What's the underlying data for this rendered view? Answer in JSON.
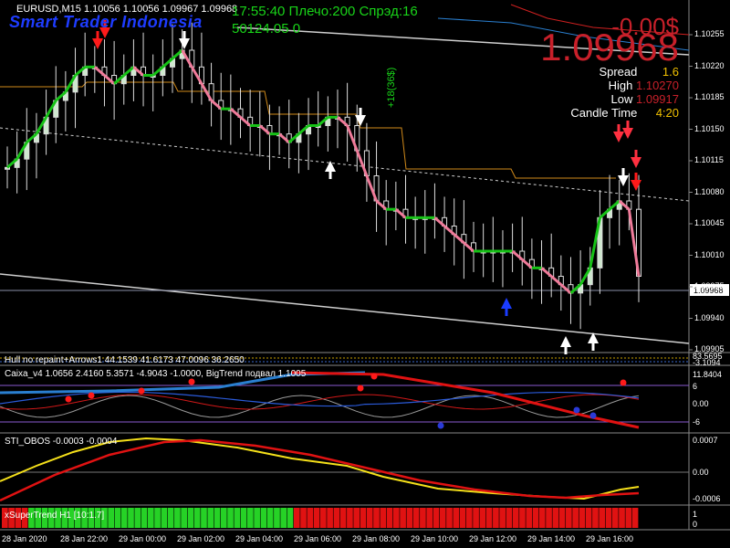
{
  "header": {
    "symbol_line": "EURUSD,M15  1.10056 1.10056 1.09967 1.09968",
    "brand": "Smart Trader Indonesia",
    "clock_line": "17:55:40 Плечо:200 Спрэд:16",
    "balance_line": "50124.05 0",
    "pnl": "-0.00$",
    "big_price": "1.09968"
  },
  "info_panel": {
    "spread_label": "Spread",
    "spread_value": "1.6",
    "high_label": "High",
    "high_value": "1.10270",
    "low_label": "Low",
    "low_value": "1.09917",
    "candle_label": "Candle Time",
    "candle_value": "4:20"
  },
  "annotation_pips": "+18(36$)",
  "subwindows": {
    "arrows": {
      "label": "Hull no repaint+Arrows1 44.1539 41.6173 47.0096 36.2650",
      "scale_top": "83.5695",
      "scale_bottom": "-3.1094"
    },
    "caixa": {
      "label": "Caixa_v4 1.0656 2.4160 5.3571 -4.9043 -1.0000, BigTrend подвал 1.1005",
      "scale": [
        "11.8404",
        "6",
        "0.00",
        "-6"
      ]
    },
    "sti": {
      "label": "STI_OBOS -0.0003 -0.0004",
      "scale": [
        "0.0007",
        "0.00",
        "-0.0006"
      ]
    },
    "xsuper": {
      "label": "xSuperTrend H1 [10:1.7]",
      "scale": [
        "1",
        "0"
      ]
    }
  },
  "chart_data": [
    {
      "type": "candlestick",
      "symbol": "EURUSD",
      "timeframe": "M15",
      "ylim": [
        1.0988,
        1.103
      ],
      "y_ticks": [
        "1.10255",
        "1.10220",
        "1.10185",
        "1.10150",
        "1.10115",
        "1.10080",
        "1.10045",
        "1.10010",
        "1.09975",
        "1.09940",
        "1.09905"
      ],
      "current_price": "1.09968",
      "x_ticks": [
        "28 Jan 2020",
        "28 Jan 22:00",
        "29 Jan 00:00",
        "29 Jan 02:00",
        "29 Jan 04:00",
        "29 Jan 06:00",
        "29 Jan 08:00",
        "29 Jan 10:00",
        "29 Jan 12:00",
        "29 Jan 14:00",
        "29 Jan 16:00"
      ],
      "close_path": [
        1.101,
        1.1011,
        1.1013,
        1.1014,
        1.1016,
        1.1018,
        1.1019,
        1.1021,
        1.1022,
        1.1022,
        1.1021,
        1.102,
        1.1021,
        1.1022,
        1.1021,
        1.1021,
        1.1022,
        1.1023,
        1.1024,
        1.1022,
        1.102,
        1.1018,
        1.1017,
        1.1017,
        1.1016,
        1.1015,
        1.1015,
        1.1014,
        1.1014,
        1.1013,
        1.1014,
        1.1015,
        1.1015,
        1.1016,
        1.1016,
        1.1015,
        1.1012,
        1.1009,
        1.1006,
        1.1005,
        1.1005,
        1.1004,
        1.1004,
        1.1004,
        1.1004,
        1.1003,
        1.1002,
        1.1001,
        1.1,
        1.1,
        1.1,
        1.1,
        1.1,
        1.0999,
        1.0998,
        1.0998,
        1.0997,
        1.0996,
        1.0995,
        1.0996,
        1.0998,
        1.1004,
        1.1005,
        1.1006,
        1.1005,
        1.0997
      ],
      "series": [
        {
          "name": "Hull",
          "color_up": "#16c216",
          "color_down": "#f07b9a"
        },
        {
          "name": "BigTrend",
          "color": "#d18a1a"
        }
      ]
    },
    {
      "type": "line",
      "name": "Caixa_v4",
      "ylim": [
        -8,
        13
      ]
    },
    {
      "type": "line",
      "name": "STI_OBOS",
      "ylim": [
        -0.0008,
        0.0008
      ],
      "series": [
        {
          "name": "fast",
          "color": "#f5e01a"
        },
        {
          "name": "slow",
          "color": "#e01212"
        }
      ]
    },
    {
      "type": "bar",
      "name": "xSuperTrend H1",
      "segments": [
        {
          "state": "bear",
          "color": "#e01212",
          "count": 4
        },
        {
          "state": "bull",
          "color": "#26d226",
          "count": 40
        },
        {
          "state": "bear",
          "color": "#e01212",
          "count": 52
        }
      ]
    }
  ]
}
